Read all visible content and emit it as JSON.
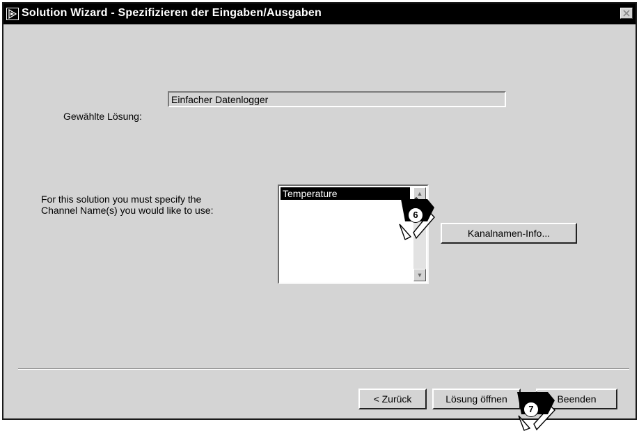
{
  "window": {
    "title": "Solution Wizard - Spezifizieren der Eingaben/Ausgaben",
    "app_icon": "wizard-app-icon",
    "close_icon": "close-icon"
  },
  "solution": {
    "label": "Gewählte Lösung:",
    "value": "Einfacher Datenlogger"
  },
  "channel": {
    "instruction_line1": "For this solution you must specify the",
    "instruction_line2": "Channel Name(s) you would like to use:",
    "items": [
      "Temperature"
    ],
    "info_button": "Kanalnamen-Info..."
  },
  "callouts": {
    "step6": "6",
    "step7": "7"
  },
  "footer": {
    "back_button": "< Zurück",
    "open_button": "Lösung öffnen",
    "finish_button": "Beenden"
  }
}
